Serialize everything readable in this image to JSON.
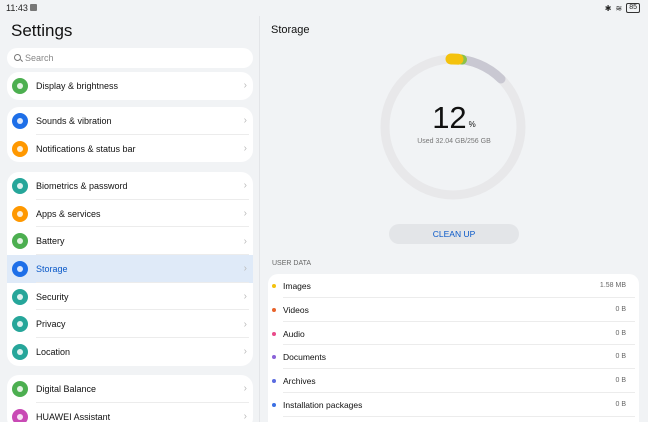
{
  "status": {
    "time": "11:43",
    "battery": "85"
  },
  "left": {
    "title": "Settings",
    "search_placeholder": "Search",
    "groups": [
      {
        "items": [
          {
            "label": "Display & brightness",
            "color": "#4caf50"
          }
        ]
      },
      {
        "items": [
          {
            "label": "Sounds & vibration",
            "color": "#1e6fe8"
          },
          {
            "label": "Notifications & status bar",
            "color": "#ff9800"
          }
        ]
      },
      {
        "items": [
          {
            "label": "Biometrics & password",
            "color": "#26a69a"
          },
          {
            "label": "Apps & services",
            "color": "#ff9800"
          },
          {
            "label": "Battery",
            "color": "#4caf50"
          },
          {
            "label": "Storage",
            "color": "#1e6fe8",
            "selected": true
          },
          {
            "label": "Security",
            "color": "#26a69a"
          },
          {
            "label": "Privacy",
            "color": "#26a69a"
          },
          {
            "label": "Location",
            "color": "#26a69a"
          }
        ]
      },
      {
        "items": [
          {
            "label": "Digital Balance",
            "color": "#4caf50"
          },
          {
            "label": "HUAWEI Assistant",
            "color": "#c94ab5"
          }
        ]
      }
    ]
  },
  "right": {
    "title": "Storage",
    "percent": "12",
    "percent_unit": "%",
    "used_text": "Used 32.04 GB/256 GB",
    "clean_label": "CLEAN UP",
    "user_data_header": "USER DATA",
    "user_data": [
      {
        "label": "Images",
        "value": "1.58 MB",
        "color": "#f4c20d"
      },
      {
        "label": "Videos",
        "value": "0 B",
        "color": "#e8632b"
      },
      {
        "label": "Audio",
        "value": "0 B",
        "color": "#e94b8a"
      },
      {
        "label": "Documents",
        "value": "0 B",
        "color": "#8a62d8"
      },
      {
        "label": "Archives",
        "value": "0 B",
        "color": "#5a6be0"
      },
      {
        "label": "Installation packages",
        "value": "0 B",
        "color": "#3b6fe3"
      }
    ]
  },
  "icons": {
    "search": "search-icon",
    "chevron": "chevron-right-icon"
  }
}
